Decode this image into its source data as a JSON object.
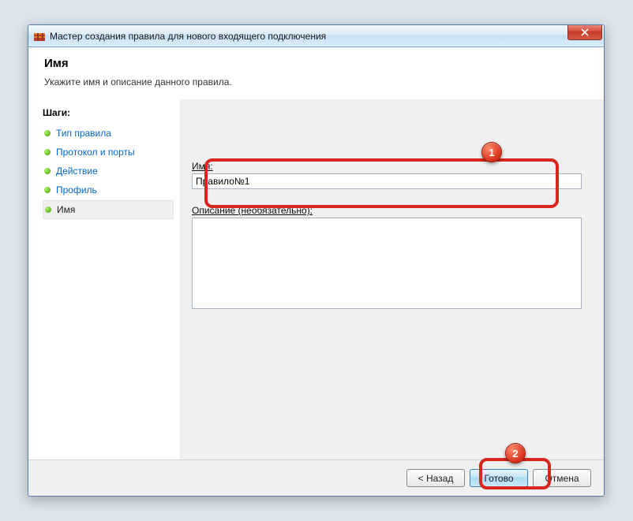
{
  "window": {
    "title": "Мастер создания правила для нового входящего подключения"
  },
  "header": {
    "title": "Имя",
    "subtitle": "Укажите имя и описание данного правила."
  },
  "sidebar": {
    "steps_label": "Шаги:",
    "items": [
      {
        "label": "Тип правила"
      },
      {
        "label": "Протокол и порты"
      },
      {
        "label": "Действие"
      },
      {
        "label": "Профиль"
      },
      {
        "label": "Имя"
      }
    ]
  },
  "form": {
    "name_label": "Имя:",
    "name_value": "Правило№1",
    "desc_label": "Описание (необязательно):",
    "desc_value": ""
  },
  "buttons": {
    "back": "< Назад",
    "finish": "Готово",
    "cancel": "Отмена"
  },
  "markers": {
    "one": "1",
    "two": "2"
  }
}
